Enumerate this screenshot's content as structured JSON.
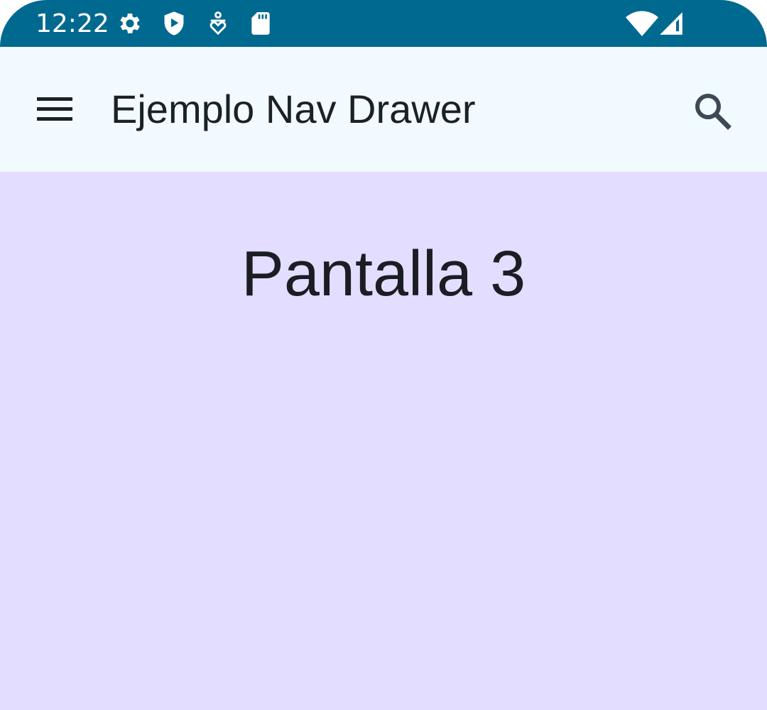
{
  "status_bar": {
    "time": "12:22",
    "icons_left": [
      "gear-icon",
      "shield-play-icon",
      "accessibility-icon",
      "sd-card-icon"
    ],
    "icons_right": [
      "wifi-icon",
      "signal-icon"
    ],
    "background": "#00698f"
  },
  "app_bar": {
    "title": "Ejemplo Nav Drawer",
    "menu_icon": "menu-icon",
    "search_icon": "search-icon",
    "background": "#f1faff"
  },
  "content": {
    "title": "Pantalla 3",
    "background": "#e3ddff"
  }
}
